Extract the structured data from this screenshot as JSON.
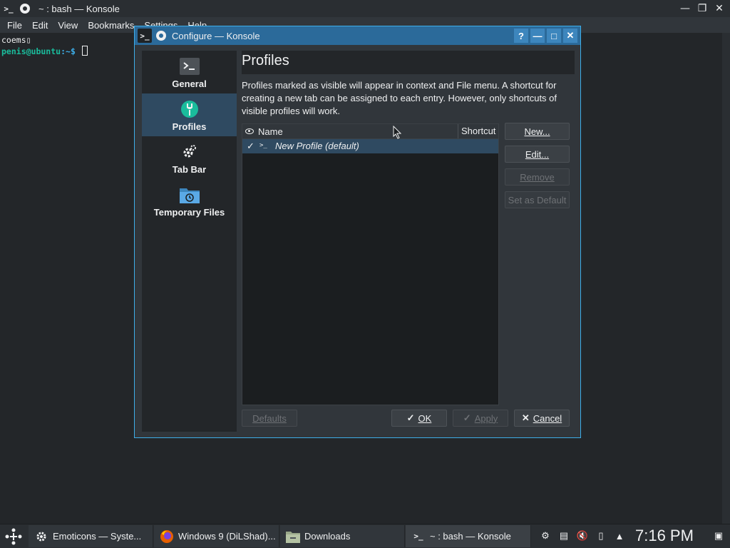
{
  "konsole": {
    "title": "~ : bash — Konsole",
    "menu": [
      "File",
      "Edit",
      "View",
      "Bookmarks",
      "Settings",
      "Help"
    ],
    "terminal": {
      "line1": "coems▯",
      "prompt_user": "penis@ubuntu",
      "prompt_path": ":~$"
    }
  },
  "dialog": {
    "title": "Configure — Konsole",
    "sidebar": [
      {
        "label": "General",
        "icon": "terminal-icon"
      },
      {
        "label": "Profiles",
        "icon": "profiles-icon"
      },
      {
        "label": "Tab Bar",
        "icon": "gears-icon"
      },
      {
        "label": "Temporary Files",
        "icon": "folder-clock-icon"
      }
    ],
    "selected_page": "Profiles",
    "page_title": "Profiles",
    "description": "Profiles marked as visible will appear in context and File menu. A shortcut for creating a new tab can be assigned to each entry. However, only shortcuts of visible profiles will work.",
    "list": {
      "col_name": "Name",
      "col_shortcut": "Shortcut",
      "rows": [
        {
          "visible": "✓",
          "name": "New Profile (default)",
          "shortcut": ""
        }
      ]
    },
    "buttons": {
      "new": "New...",
      "edit": "Edit...",
      "remove": "Remove",
      "set_default": "Set as Default",
      "defaults": "Defaults",
      "ok": "OK",
      "apply": "Apply",
      "cancel": "Cancel"
    }
  },
  "taskbar": {
    "tasks": [
      {
        "label": "Emoticons  — Syste...",
        "icon": "settings-icon"
      },
      {
        "label": "Windows 9 (DiLShad)...",
        "icon": "firefox-icon"
      },
      {
        "label": "Downloads",
        "icon": "folder-icon"
      },
      {
        "label": "~ : bash — Konsole",
        "icon": "terminal-icon"
      }
    ],
    "clock": "7:16 PM"
  },
  "colors": {
    "accent": "#3daee9",
    "selection": "#2f4a61",
    "window_bg": "#31363b",
    "terminal_user": "#1abc9c"
  }
}
